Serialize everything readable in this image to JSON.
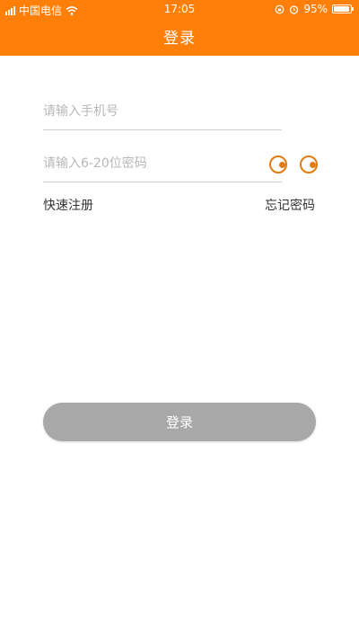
{
  "status_bar": {
    "carrier": "中国电信",
    "time": "17:05",
    "battery": "95%",
    "battery_level": 0.95
  },
  "header": {
    "title": "登录"
  },
  "form": {
    "phone_placeholder": "请输入手机号",
    "password_placeholder": "请输入6-20位密码",
    "register_label": "快速注册",
    "forgot_label": "忘记密码",
    "login_label": "登录"
  },
  "colors": {
    "accent": "#ff7f08",
    "eye_icon": "#e07b10",
    "button_disabled": "#a8a8a8"
  },
  "icons": {
    "signal": "signal-icon",
    "wifi": "wifi-icon",
    "lock_rotation": "lock-rotation-icon",
    "alarm": "alarm-icon",
    "battery": "battery-icon",
    "password_visibility": "eye-icon"
  }
}
